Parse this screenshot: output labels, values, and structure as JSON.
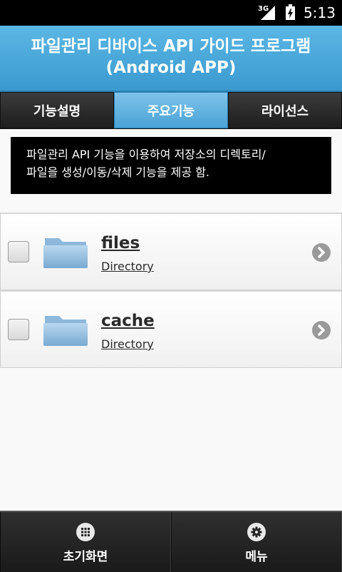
{
  "status_bar": {
    "network": "3G",
    "time": "5:13"
  },
  "header": {
    "title_line1": "파일관리 디바이스 API 가이드 프로그램",
    "title_line2": "(Android APP)"
  },
  "tabs": [
    {
      "label": "기능설명",
      "active": false
    },
    {
      "label": "주요기능",
      "active": true
    },
    {
      "label": "라이선스",
      "active": false
    }
  ],
  "description": {
    "line1": "파일관리 API 기능을 이용하여 저장소의 디렉토리/",
    "line2": "파일을 생성/이동/삭제 기능을 제공 함."
  },
  "items": [
    {
      "name": "files",
      "type": "Directory",
      "checked": false,
      "icon": "folder-icon"
    },
    {
      "name": "cache",
      "type": "Directory",
      "checked": false,
      "icon": "folder-icon"
    }
  ],
  "bottom_bar": {
    "home_label": "초기화면",
    "menu_label": "메뉴"
  },
  "colors": {
    "header": "#3a99cf",
    "active_tab": "#4aa3d6",
    "bar_dark": "#1e1e1e"
  }
}
